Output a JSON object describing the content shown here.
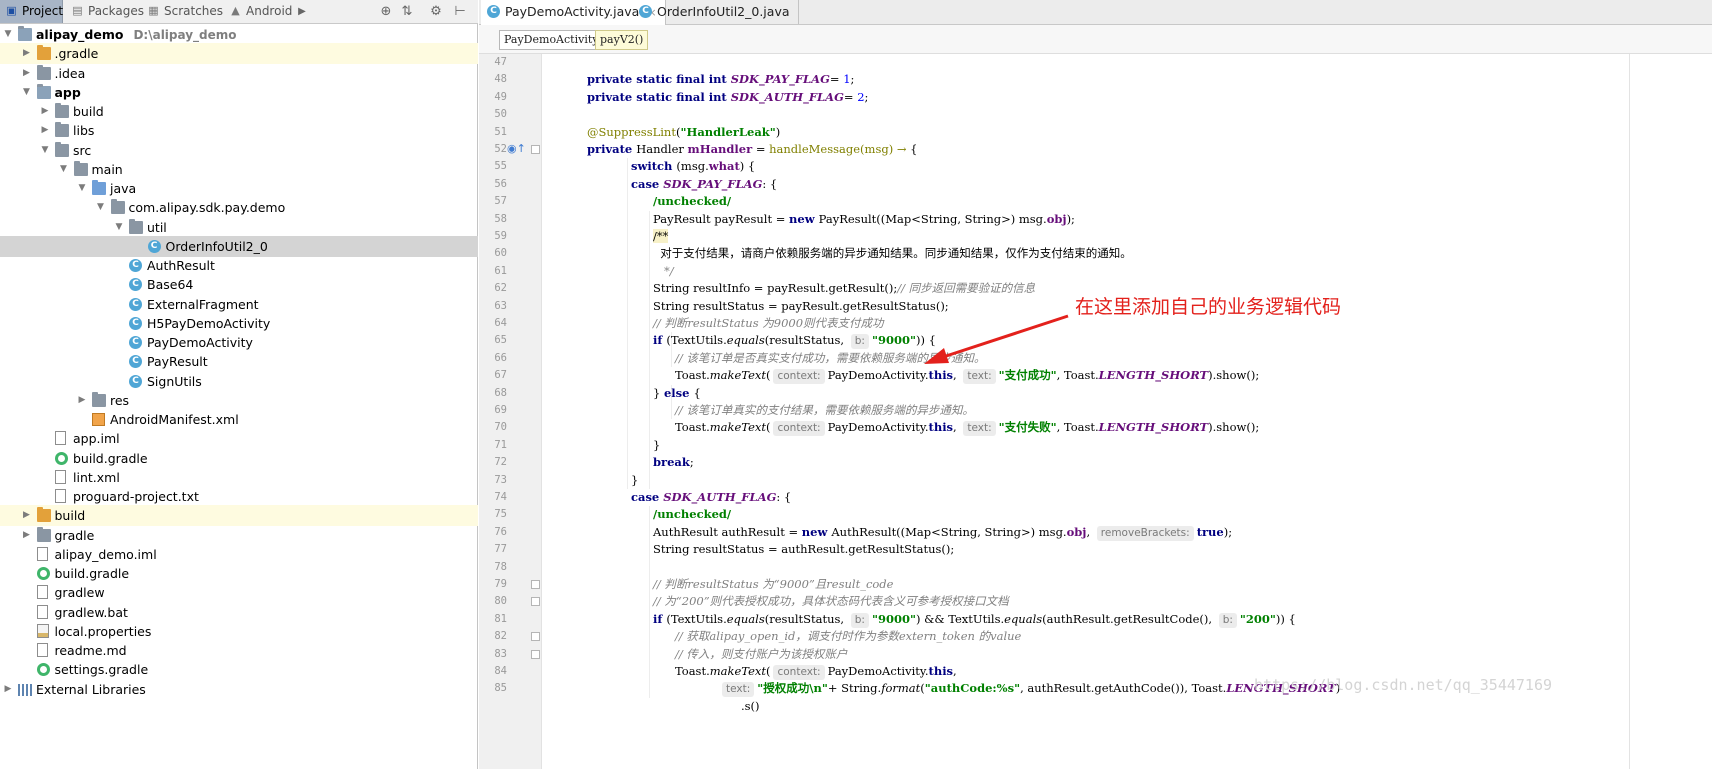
{
  "project_pane": {
    "tabs": [
      {
        "label": "Project",
        "icon": "project-icon"
      },
      {
        "label": "Packages",
        "icon": "packages-icon"
      },
      {
        "label": "Scratches",
        "icon": "scratches-icon"
      },
      {
        "label": "Android",
        "icon": "android-icon"
      }
    ],
    "more_arrow": "▶",
    "tools": [
      "⊕",
      "⇅",
      "⚙",
      "⊢"
    ],
    "tree": [
      {
        "depth": 0,
        "arrow": "down",
        "icon": "module",
        "label": "alipay_demo",
        "path": "D:\\alipay_demo",
        "bold": true
      },
      {
        "depth": 1,
        "arrow": "right",
        "icon": "folder-orange",
        "label": ".gradle",
        "highlight": true
      },
      {
        "depth": 1,
        "arrow": "right",
        "icon": "folder",
        "label": ".idea"
      },
      {
        "depth": 1,
        "arrow": "down",
        "icon": "module",
        "label": "app",
        "bold": true
      },
      {
        "depth": 2,
        "arrow": "right",
        "icon": "folder",
        "label": "build"
      },
      {
        "depth": 2,
        "arrow": "right",
        "icon": "folder",
        "label": "libs"
      },
      {
        "depth": 2,
        "arrow": "down",
        "icon": "folder",
        "label": "src"
      },
      {
        "depth": 3,
        "arrow": "down",
        "icon": "folder",
        "label": "main"
      },
      {
        "depth": 4,
        "arrow": "down",
        "icon": "folder-blue",
        "label": "java"
      },
      {
        "depth": 5,
        "arrow": "down",
        "icon": "folder",
        "label": "com.alipay.sdk.pay.demo"
      },
      {
        "depth": 6,
        "arrow": "down",
        "icon": "folder",
        "label": "util"
      },
      {
        "depth": 7,
        "arrow": "none",
        "icon": "class",
        "label": "OrderInfoUtil2_0",
        "selected": true
      },
      {
        "depth": 6,
        "arrow": "none",
        "icon": "class",
        "label": "AuthResult"
      },
      {
        "depth": 6,
        "arrow": "none",
        "icon": "class",
        "label": "Base64"
      },
      {
        "depth": 6,
        "arrow": "none",
        "icon": "class",
        "label": "ExternalFragment"
      },
      {
        "depth": 6,
        "arrow": "none",
        "icon": "class",
        "label": "H5PayDemoActivity"
      },
      {
        "depth": 6,
        "arrow": "none",
        "icon": "class",
        "label": "PayDemoActivity"
      },
      {
        "depth": 6,
        "arrow": "none",
        "icon": "class",
        "label": "PayResult"
      },
      {
        "depth": 6,
        "arrow": "none",
        "icon": "class",
        "label": "SignUtils"
      },
      {
        "depth": 4,
        "arrow": "right",
        "icon": "folder",
        "label": "res"
      },
      {
        "depth": 4,
        "arrow": "none",
        "icon": "xml",
        "label": "AndroidManifest.xml"
      },
      {
        "depth": 2,
        "arrow": "none",
        "icon": "file",
        "label": "app.iml"
      },
      {
        "depth": 2,
        "arrow": "none",
        "icon": "gradle",
        "label": "build.gradle"
      },
      {
        "depth": 2,
        "arrow": "none",
        "icon": "file",
        "label": "lint.xml"
      },
      {
        "depth": 2,
        "arrow": "none",
        "icon": "file",
        "label": "proguard-project.txt"
      },
      {
        "depth": 1,
        "arrow": "right",
        "icon": "folder-orange",
        "label": "build",
        "highlight": true
      },
      {
        "depth": 1,
        "arrow": "right",
        "icon": "folder",
        "label": "gradle"
      },
      {
        "depth": 1,
        "arrow": "none",
        "icon": "file",
        "label": "alipay_demo.iml"
      },
      {
        "depth": 1,
        "arrow": "none",
        "icon": "gradle",
        "label": "build.gradle"
      },
      {
        "depth": 1,
        "arrow": "none",
        "icon": "file",
        "label": "gradlew"
      },
      {
        "depth": 1,
        "arrow": "none",
        "icon": "file",
        "label": "gradlew.bat"
      },
      {
        "depth": 1,
        "arrow": "none",
        "icon": "properties",
        "label": "local.properties"
      },
      {
        "depth": 1,
        "arrow": "none",
        "icon": "file",
        "label": "readme.md"
      },
      {
        "depth": 1,
        "arrow": "none",
        "icon": "gradle",
        "label": "settings.gradle"
      },
      {
        "depth": 0,
        "arrow": "right",
        "icon": "library",
        "label": "External Libraries"
      }
    ]
  },
  "editor": {
    "tabs": [
      {
        "label": "PayDemoActivity.java",
        "active": true,
        "close": "×"
      },
      {
        "label": "OrderInfoUtil2_0.java",
        "active": false,
        "close": ""
      }
    ],
    "breadcrumb": [
      "PayDemoActivity",
      "payV2()"
    ],
    "lines": [
      {
        "n": "47",
        "indent": 0,
        "parts": []
      },
      {
        "n": "48",
        "indent": 1,
        "parts": [
          [
            "kw",
            "private static final int "
          ],
          [
            "cst",
            "SDK_PAY_FLAG"
          ],
          [
            "",
            "= "
          ],
          [
            "num",
            "1"
          ],
          [
            "",
            ";"
          ]
        ]
      },
      {
        "n": "49",
        "indent": 1,
        "parts": [
          [
            "kw",
            "private static final int "
          ],
          [
            "cst",
            "SDK_AUTH_FLAG"
          ],
          [
            "",
            "= "
          ],
          [
            "num",
            "2"
          ],
          [
            "",
            ";"
          ]
        ]
      },
      {
        "n": "50",
        "indent": 0,
        "parts": []
      },
      {
        "n": "51",
        "indent": 1,
        "parts": [
          [
            "ann",
            "@SuppressLint"
          ],
          [
            "",
            "("
          ],
          [
            "str",
            "\"HandlerLeak\""
          ],
          [
            "",
            ")"
          ]
        ]
      },
      {
        "n": "52",
        "indent": 1,
        "parts": [
          [
            "kw",
            "private "
          ],
          [
            "",
            "Handler "
          ],
          [
            "fld",
            "mHandler"
          ],
          [
            "",
            " = "
          ],
          [
            "lam",
            "handleMessage(msg) → "
          ],
          [
            "",
            "{"
          ]
        ]
      },
      {
        "n": "55",
        "indent": 3,
        "parts": [
          [
            "kw",
            "switch "
          ],
          [
            "",
            "(msg."
          ],
          [
            "fld",
            "what"
          ],
          [
            "",
            ") {"
          ]
        ]
      },
      {
        "n": "56",
        "indent": 3,
        "parts": [
          [
            "kw",
            "case "
          ],
          [
            "cst",
            "SDK_PAY_FLAG"
          ],
          [
            "",
            ": {"
          ]
        ]
      },
      {
        "n": "57",
        "indent": 4,
        "parts": [
          [
            "str",
            "/unchecked/"
          ]
        ]
      },
      {
        "n": "58",
        "indent": 4,
        "parts": [
          [
            "",
            "PayResult payResult = "
          ],
          [
            "kw",
            "new "
          ],
          [
            "",
            "PayResult((Map<String, String>) msg."
          ],
          [
            "fld",
            "obj"
          ],
          [
            "",
            ");"
          ]
        ]
      },
      {
        "n": "59",
        "indent": 4,
        "parts": [
          [
            "dochl",
            "/**"
          ]
        ]
      },
      {
        "n": "60",
        "indent": 4,
        "parts": [
          [
            "",
            "  对于支付结果，请商户依赖服务端的异步通知结果。同步通知结果，仅作为支付结束的通知。"
          ]
        ]
      },
      {
        "n": "61",
        "indent": 4,
        "parts": [
          [
            "doc",
            "   */"
          ]
        ]
      },
      {
        "n": "62",
        "indent": 4,
        "parts": [
          [
            "",
            "String resultInfo = payResult.getResult();"
          ],
          [
            "cmt",
            "// 同步返回需要验证的信息"
          ]
        ]
      },
      {
        "n": "63",
        "indent": 4,
        "parts": [
          [
            "",
            "String resultStatus = payResult.getResultStatus();"
          ]
        ]
      },
      {
        "n": "64",
        "indent": 4,
        "parts": [
          [
            "cmt",
            "// 判断resultStatus 为9000则代表支付成功"
          ]
        ]
      },
      {
        "n": "65",
        "indent": 4,
        "parts": [
          [
            "kw",
            "if "
          ],
          [
            "",
            "(TextUtils."
          ],
          [
            "meth",
            "equals"
          ],
          [
            "",
            "(resultStatus, "
          ],
          [
            "hint",
            "b:"
          ],
          [
            "str",
            "\"9000\""
          ],
          [
            "",
            ")) {"
          ]
        ]
      },
      {
        "n": "66",
        "indent": 5,
        "parts": [
          [
            "cmt",
            "// 该笔订单是否真实支付成功，需要依赖服务端的异步通知。"
          ]
        ]
      },
      {
        "n": "67",
        "indent": 5,
        "parts": [
          [
            "",
            "Toast."
          ],
          [
            "meth",
            "makeText"
          ],
          [
            "",
            "("
          ],
          [
            "hint",
            "context:"
          ],
          [
            "",
            "PayDemoActivity."
          ],
          [
            "kw",
            "this"
          ],
          [
            "",
            ", "
          ],
          [
            "hint",
            "text:"
          ],
          [
            "str",
            "\"支付成功\""
          ],
          [
            "",
            ", Toast."
          ],
          [
            "cst",
            "LENGTH_SHORT"
          ],
          [
            "",
            ").show();"
          ]
        ]
      },
      {
        "n": "68",
        "indent": 4,
        "parts": [
          [
            "",
            "} "
          ],
          [
            "kw",
            "else "
          ],
          [
            "",
            "{"
          ]
        ]
      },
      {
        "n": "69",
        "indent": 5,
        "parts": [
          [
            "cmt",
            "// 该笔订单真实的支付结果，需要依赖服务端的异步通知。"
          ]
        ]
      },
      {
        "n": "70",
        "indent": 5,
        "parts": [
          [
            "",
            "Toast."
          ],
          [
            "meth",
            "makeText"
          ],
          [
            "",
            "("
          ],
          [
            "hint",
            "context:"
          ],
          [
            "",
            "PayDemoActivity."
          ],
          [
            "kw",
            "this"
          ],
          [
            "",
            ", "
          ],
          [
            "hint",
            "text:"
          ],
          [
            "str",
            "\"支付失败\""
          ],
          [
            "",
            ", Toast."
          ],
          [
            "cst",
            "LENGTH_SHORT"
          ],
          [
            "",
            ").show();"
          ]
        ]
      },
      {
        "n": "71",
        "indent": 4,
        "parts": [
          [
            "",
            "}"
          ]
        ]
      },
      {
        "n": "72",
        "indent": 4,
        "parts": [
          [
            "kw",
            "break"
          ],
          [
            "",
            ";"
          ]
        ]
      },
      {
        "n": "73",
        "indent": 3,
        "parts": [
          [
            "",
            "}"
          ]
        ]
      },
      {
        "n": "74",
        "indent": 3,
        "parts": [
          [
            "kw",
            "case "
          ],
          [
            "cst",
            "SDK_AUTH_FLAG"
          ],
          [
            "",
            ": {"
          ]
        ]
      },
      {
        "n": "75",
        "indent": 4,
        "parts": [
          [
            "str",
            "/unchecked/"
          ]
        ]
      },
      {
        "n": "76",
        "indent": 4,
        "parts": [
          [
            "",
            "AuthResult authResult = "
          ],
          [
            "kw",
            "new "
          ],
          [
            "",
            "AuthResult((Map<String, String>) msg."
          ],
          [
            "fld",
            "obj"
          ],
          [
            "",
            ", "
          ],
          [
            "hint",
            "removeBrackets:"
          ],
          [
            "kw",
            "true"
          ],
          [
            "",
            ");"
          ]
        ]
      },
      {
        "n": "77",
        "indent": 4,
        "parts": [
          [
            "",
            "String resultStatus = authResult.getResultStatus();"
          ]
        ]
      },
      {
        "n": "78",
        "indent": 0,
        "parts": []
      },
      {
        "n": "79",
        "indent": 4,
        "parts": [
          [
            "cmt",
            "// 判断resultStatus 为“9000”且result_code"
          ]
        ]
      },
      {
        "n": "80",
        "indent": 4,
        "parts": [
          [
            "cmt",
            "// 为“200”则代表授权成功，具体状态码代表含义可参考授权接口文档"
          ]
        ]
      },
      {
        "n": "81",
        "indent": 4,
        "parts": [
          [
            "kw",
            "if "
          ],
          [
            "",
            "(TextUtils."
          ],
          [
            "meth",
            "equals"
          ],
          [
            "",
            "(resultStatus, "
          ],
          [
            "hint",
            "b:"
          ],
          [
            "str",
            "\"9000\""
          ],
          [
            "",
            ") && TextUtils."
          ],
          [
            "meth",
            "equals"
          ],
          [
            "",
            "(authResult.getResultCode(), "
          ],
          [
            "hint",
            "b:"
          ],
          [
            "str",
            "\"200\""
          ],
          [
            "",
            ")) {"
          ]
        ]
      },
      {
        "n": "82",
        "indent": 5,
        "parts": [
          [
            "cmt",
            "// 获取alipay_open_id，调支付时作为参数extern_token 的value"
          ]
        ]
      },
      {
        "n": "83",
        "indent": 5,
        "parts": [
          [
            "cmt",
            "// 传入，则支付账户为该授权账户"
          ]
        ]
      },
      {
        "n": "84",
        "indent": 5,
        "parts": [
          [
            "",
            "Toast."
          ],
          [
            "meth",
            "makeText"
          ],
          [
            "",
            "("
          ],
          [
            "hint",
            "context:"
          ],
          [
            "",
            "PayDemoActivity."
          ],
          [
            "kw",
            "this"
          ],
          [
            "",
            ","
          ]
        ]
      },
      {
        "n": "85",
        "indent": 7,
        "parts": [
          [
            "hint",
            "text:"
          ],
          [
            "str",
            "\"授权成功\\n\""
          ],
          [
            "",
            "+ String."
          ],
          [
            "meth",
            "format"
          ],
          [
            "",
            "("
          ],
          [
            "str",
            "\"authCode:%s\""
          ],
          [
            "",
            ", authResult.getAuthCode()), Toast."
          ],
          [
            "cst",
            "LENGTH_SHORT"
          ],
          [
            "",
            ")"
          ]
        ]
      },
      {
        "n": "",
        "indent": 8,
        "parts": [
          [
            "",
            ".s()"
          ]
        ]
      }
    ],
    "annotation": "在这里添加自己的业务逻辑代码",
    "watermark": "https://blog.csdn.net/qq_35447169"
  }
}
